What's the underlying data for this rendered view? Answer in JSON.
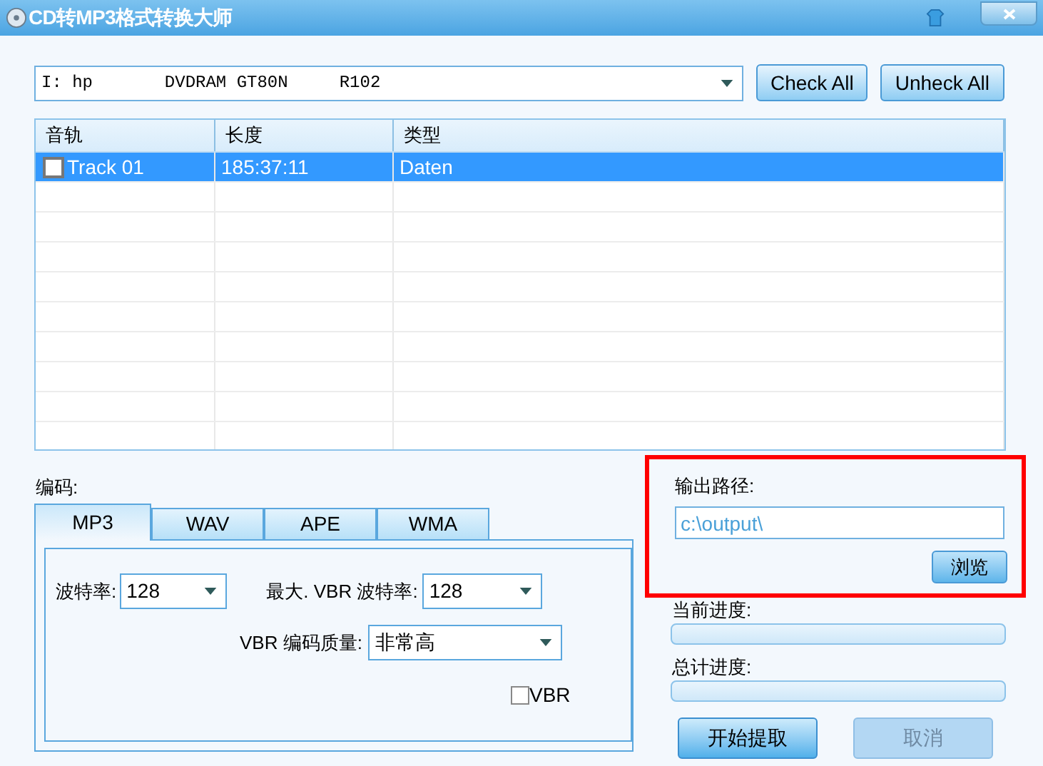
{
  "window": {
    "title": "CD转MP3格式转换大师"
  },
  "drive": {
    "value": "I: hp       DVDRAM GT80N     R102"
  },
  "buttons": [
    {
      "label": "Check All"
    },
    {
      "label": "Unheck All"
    }
  ],
  "table": {
    "columns": [
      "音轨",
      "长度",
      "类型"
    ],
    "rows": [
      {
        "cells": [
          "Track 01",
          "185:37:11",
          "Daten"
        ],
        "checked": false,
        "selected": true
      }
    ]
  },
  "encoding": {
    "label": "编码:",
    "tabs": [
      {
        "label": "MP3",
        "selected": true
      },
      {
        "label": "WAV",
        "selected": false
      },
      {
        "label": "APE",
        "selected": false
      },
      {
        "label": "WMA",
        "selected": false
      }
    ],
    "bitrate": {
      "label": "波特率:",
      "value": "128"
    },
    "max_vbr_bitrate": {
      "label": "最大. VBR 波特率:",
      "value": "128"
    },
    "vbr_quality": {
      "label": "VBR 编码质量:",
      "value": "非常高"
    },
    "vbr": {
      "label": "VBR",
      "checked": false
    }
  },
  "output": {
    "label": "输出路径:",
    "placeholder": "c:\\output\\",
    "browse": "浏览"
  },
  "progress": [
    {
      "label": "当前进度:",
      "level": 0
    },
    {
      "label": "总计进度:",
      "level": 0
    }
  ],
  "actions": [
    {
      "label": "开始提取",
      "disabled": false
    },
    {
      "label": "取消",
      "disabled": true
    }
  ]
}
